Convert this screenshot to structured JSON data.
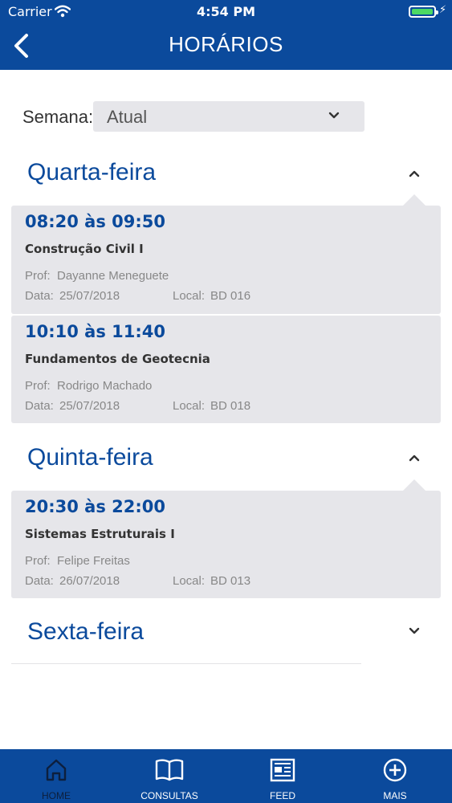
{
  "status_bar": {
    "carrier": "Carrier",
    "time": "4:54 PM"
  },
  "header": {
    "title": "HORÁRIOS"
  },
  "week": {
    "label": "Semana:",
    "value": "Atual"
  },
  "days": [
    {
      "name": "Quarta-feira",
      "expanded": true,
      "classes": [
        {
          "time": "08:20 às 09:50",
          "course": "Construção Civil I",
          "prof_label": "Prof:",
          "prof": "Dayanne Meneguete",
          "date_label": "Data:",
          "date": "25/07/2018",
          "local_label": "Local:",
          "local": "BD 016"
        },
        {
          "time": "10:10 às 11:40",
          "course": "Fundamentos de Geotecnia",
          "prof_label": "Prof:",
          "prof": "Rodrigo Machado",
          "date_label": "Data:",
          "date": "25/07/2018",
          "local_label": "Local:",
          "local": "BD 018"
        }
      ]
    },
    {
      "name": "Quinta-feira",
      "expanded": true,
      "classes": [
        {
          "time": "20:30 às 22:00",
          "course": "Sistemas Estruturais I",
          "prof_label": "Prof:",
          "prof": "Felipe Freitas",
          "date_label": "Data:",
          "date": "26/07/2018",
          "local_label": "Local:",
          "local": "BD 013"
        }
      ]
    },
    {
      "name": "Sexta-feira",
      "expanded": false,
      "classes": []
    }
  ],
  "tabbar": [
    {
      "label": "HOME",
      "icon": "home-icon",
      "active": true
    },
    {
      "label": "CONSULTAS",
      "icon": "book-icon",
      "active": false
    },
    {
      "label": "FEED",
      "icon": "newspaper-icon",
      "active": false
    },
    {
      "label": "MAIS",
      "icon": "plus-circle-icon",
      "active": false
    }
  ],
  "colors": {
    "primary": "#0b4a9c",
    "card": "#e6e6ea",
    "active_tab": "#0d1f3d",
    "battery": "#4cd964"
  }
}
